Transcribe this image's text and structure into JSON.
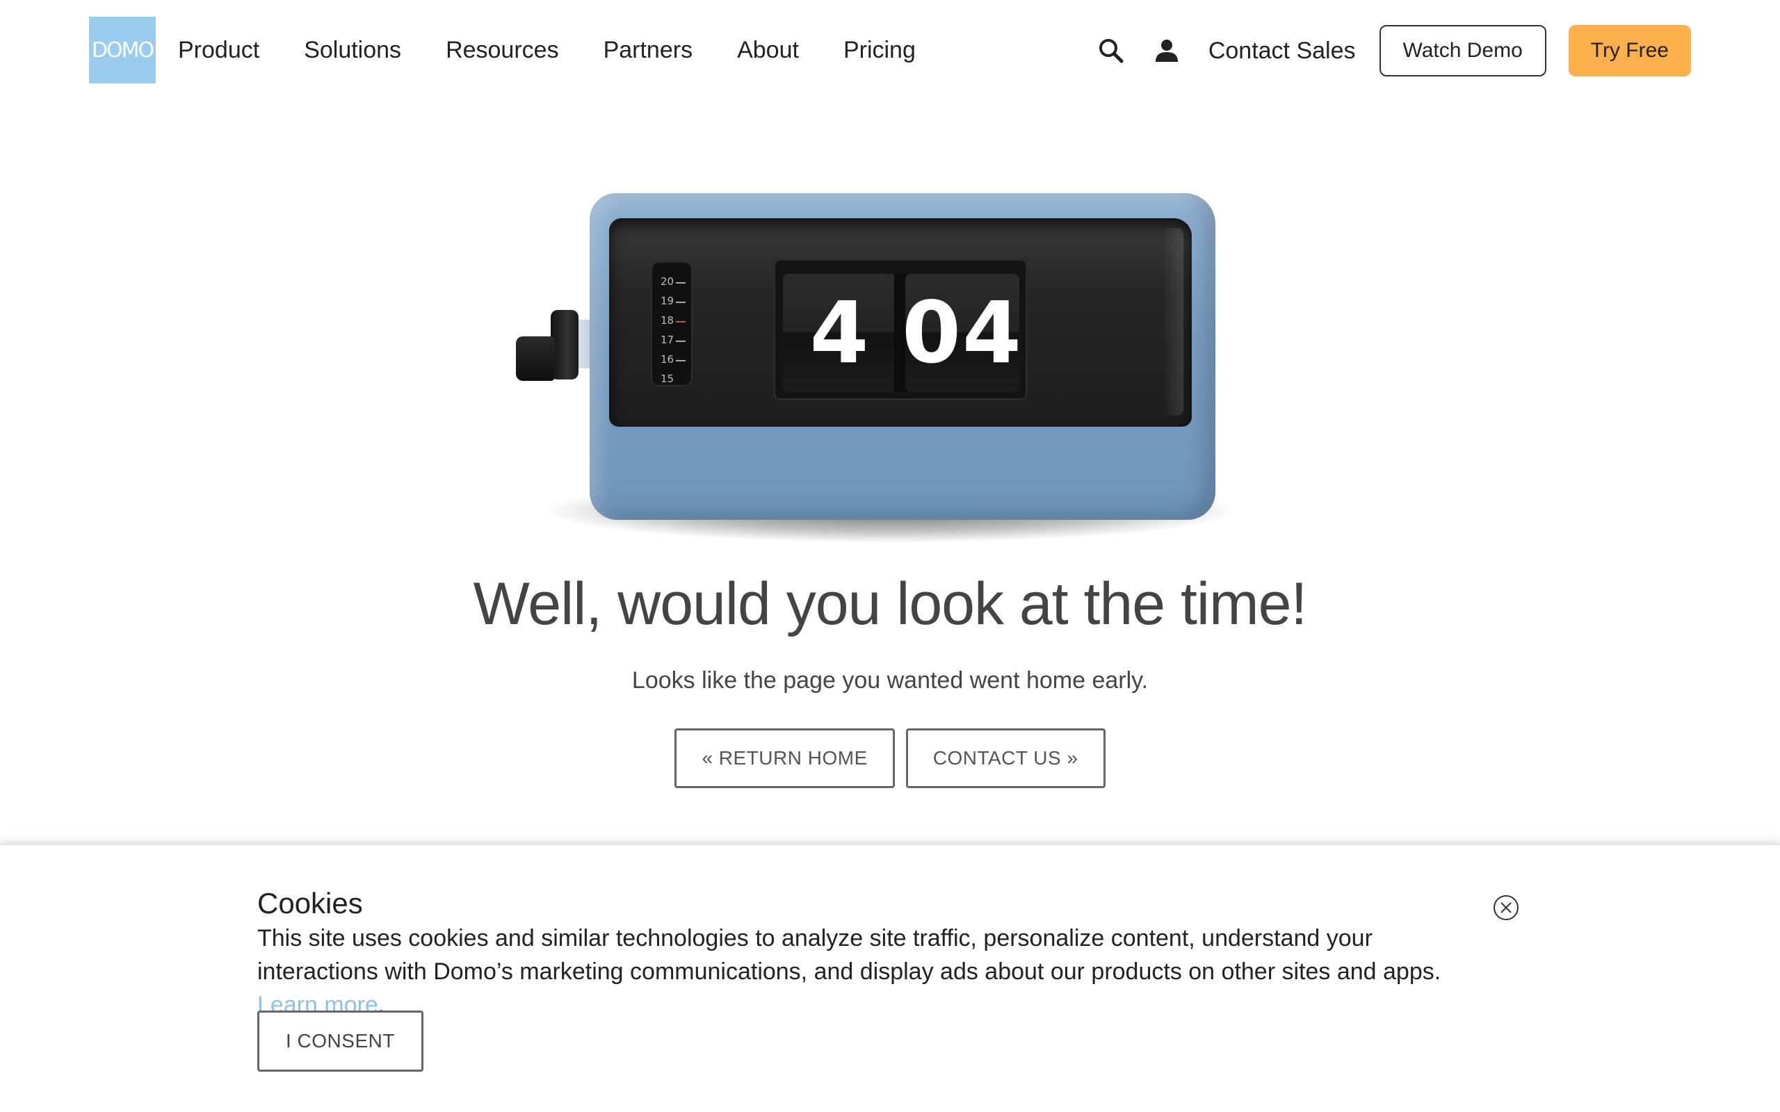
{
  "nav": {
    "logo_text": "DOMO",
    "links": [
      "Product",
      "Solutions",
      "Resources",
      "Partners",
      "About",
      "Pricing"
    ],
    "contact_sales": "Contact Sales",
    "watch_demo": "Watch Demo",
    "try_free": "Try Free",
    "icons": [
      "search-icon",
      "user-icon"
    ]
  },
  "clock": {
    "hour": "4",
    "minutes": "04",
    "dial_labels": [
      "20",
      "19",
      "18",
      "17",
      "16",
      "15"
    ]
  },
  "hero": {
    "headline": "Well, would you look at the time!",
    "subline": "Looks like the page you wanted went home early.",
    "return_home": "« RETURN HOME",
    "contact_us": "CONTACT US »"
  },
  "cookie": {
    "title": "Cookies",
    "text": "This site uses cookies and similar technologies to analyze site traffic, personalize content, understand your interactions with Domo’s marketing communications, and display ads about our products on other sites and apps.",
    "learn_more": "Learn more",
    "period": ".",
    "consent": "I CONSENT",
    "close_icon": "close-circle-icon"
  },
  "colors": {
    "logo": "#99ccee",
    "try_free": "#fbb04b",
    "clock_body": "#7b9fc3",
    "link": "#8ec3e6"
  }
}
